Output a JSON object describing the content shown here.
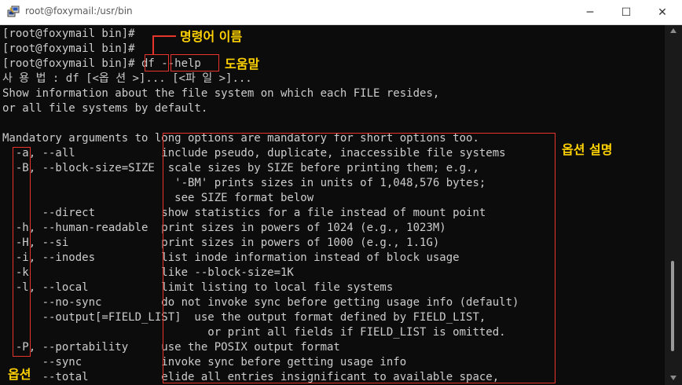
{
  "window": {
    "title": "root@foxymail:/usr/bin",
    "icon": "putty-icon",
    "controls": {
      "minimize": "─",
      "maximize": "☐",
      "close": "✕"
    }
  },
  "terminal": {
    "lines": [
      "[root@foxymail bin]#",
      "[root@foxymail bin]#",
      "[root@foxymail bin]# df --help",
      "사 용 법 : df [<옵 션 >]... [<파 일 >]...",
      "Show information about the file system on which each FILE resides,",
      "or all file systems by default.",
      "",
      "Mandatory arguments to long options are mandatory for short options too.",
      "  -a, --all             include pseudo, duplicate, inaccessible file systems",
      "  -B, --block-size=SIZE  scale sizes by SIZE before printing them; e.g.,",
      "                          '-BM' prints sizes in units of 1,048,576 bytes;",
      "                          see SIZE format below",
      "      --direct          show statistics for a file instead of mount point",
      "  -h, --human-readable  print sizes in powers of 1024 (e.g., 1023M)",
      "  -H, --si              print sizes in powers of 1000 (e.g., 1.1G)",
      "  -i, --inodes          list inode information instead of block usage",
      "  -k                    like --block-size=1K",
      "  -l, --local           limit listing to local file systems",
      "      --no-sync         do not invoke sync before getting usage info (default)",
      "      --output[=FIELD_LIST]  use the output format defined by FIELD_LIST,",
      "                               or print all fields if FIELD_LIST is omitted.",
      "  -P, --portability     use the POSIX output format",
      "      --sync            invoke sync before getting usage info",
      "      --total           elide all entries insignificant to available space,"
    ]
  },
  "annotations": {
    "command_name": "명령어 이름",
    "help": "도움말",
    "option_desc": "옵션 설명",
    "options": "옵션"
  },
  "colors": {
    "terminal_bg": "#0c0c0c",
    "terminal_text": "#cccccc",
    "annotation_box": "#e8352c",
    "annotation_text": "#ffd200"
  }
}
